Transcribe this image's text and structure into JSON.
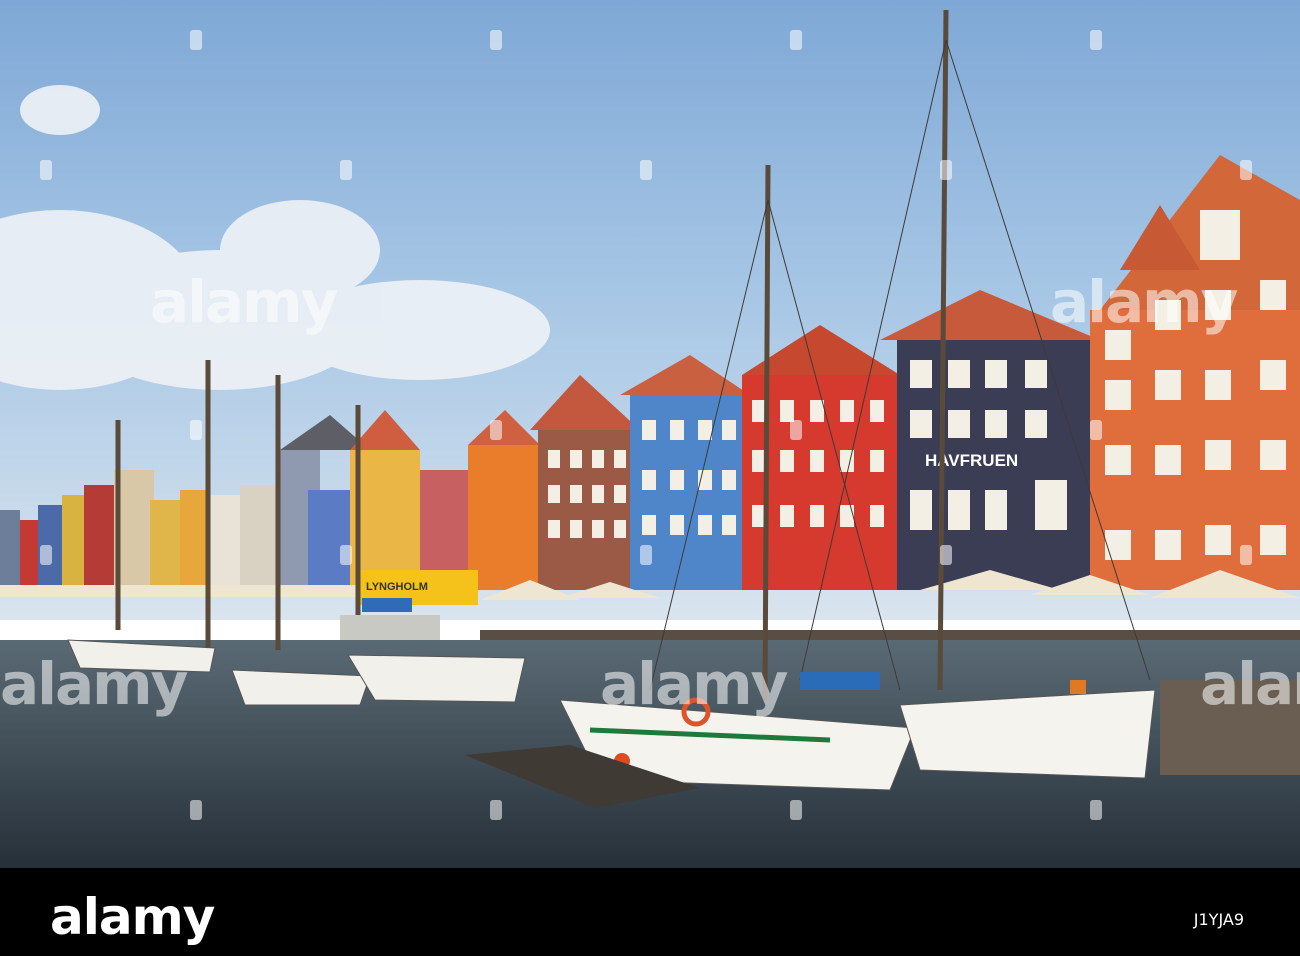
{
  "photo": {
    "sign_havfruen": "HAVFRUEN",
    "sign_crane": "LYNGHOLM"
  },
  "watermark": {
    "text": "alamy"
  },
  "footer": {
    "brand": "alamy",
    "image_id": "J1YJA9"
  },
  "colors": {
    "sky": "#a9c8e6",
    "water": "#3a4a55",
    "footer_bg": "#000000"
  }
}
